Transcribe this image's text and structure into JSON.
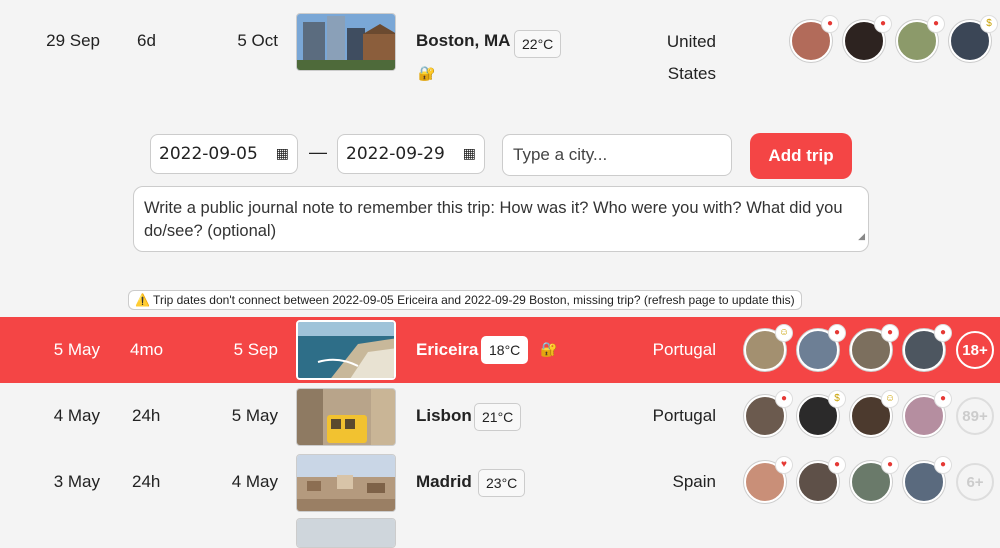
{
  "boston": {
    "start": "29 Sep",
    "duration": "6d",
    "end": "5 Oct",
    "city": "Boston, MA",
    "temp": "22°C",
    "country_line1": "United",
    "country_line2": "States",
    "lock": "🔐"
  },
  "form": {
    "date_from": "2022-09-05",
    "date_to": "2022-09-29",
    "dash": "—",
    "city_placeholder": "Type a city...",
    "add_label": "Add trip",
    "note_placeholder": "Write a public journal note to remember this trip: How was it? Who were you with? What did you do/see? (optional)"
  },
  "warning": "⚠️ Trip dates don't connect between 2022-09-05 Ericeira and 2022-09-29 Boston, missing trip? (refresh page to update this)",
  "trips": [
    {
      "start": "5 May",
      "duration": "4mo",
      "end": "5 Sep",
      "city": "Ericeira",
      "temp": "18°C",
      "country": "Portugal",
      "more": "18+",
      "lock": "🔐"
    },
    {
      "start": "4 May",
      "duration": "24h",
      "end": "5 May",
      "city": "Lisbon",
      "temp": "21°C",
      "country": "Portugal",
      "more": "89+"
    },
    {
      "start": "3 May",
      "duration": "24h",
      "end": "4 May",
      "city": "Madrid",
      "temp": "23°C",
      "country": "Spain",
      "more": "6+"
    }
  ],
  "colors": {
    "accent": "#f44545",
    "background": "#f4f4f4"
  }
}
